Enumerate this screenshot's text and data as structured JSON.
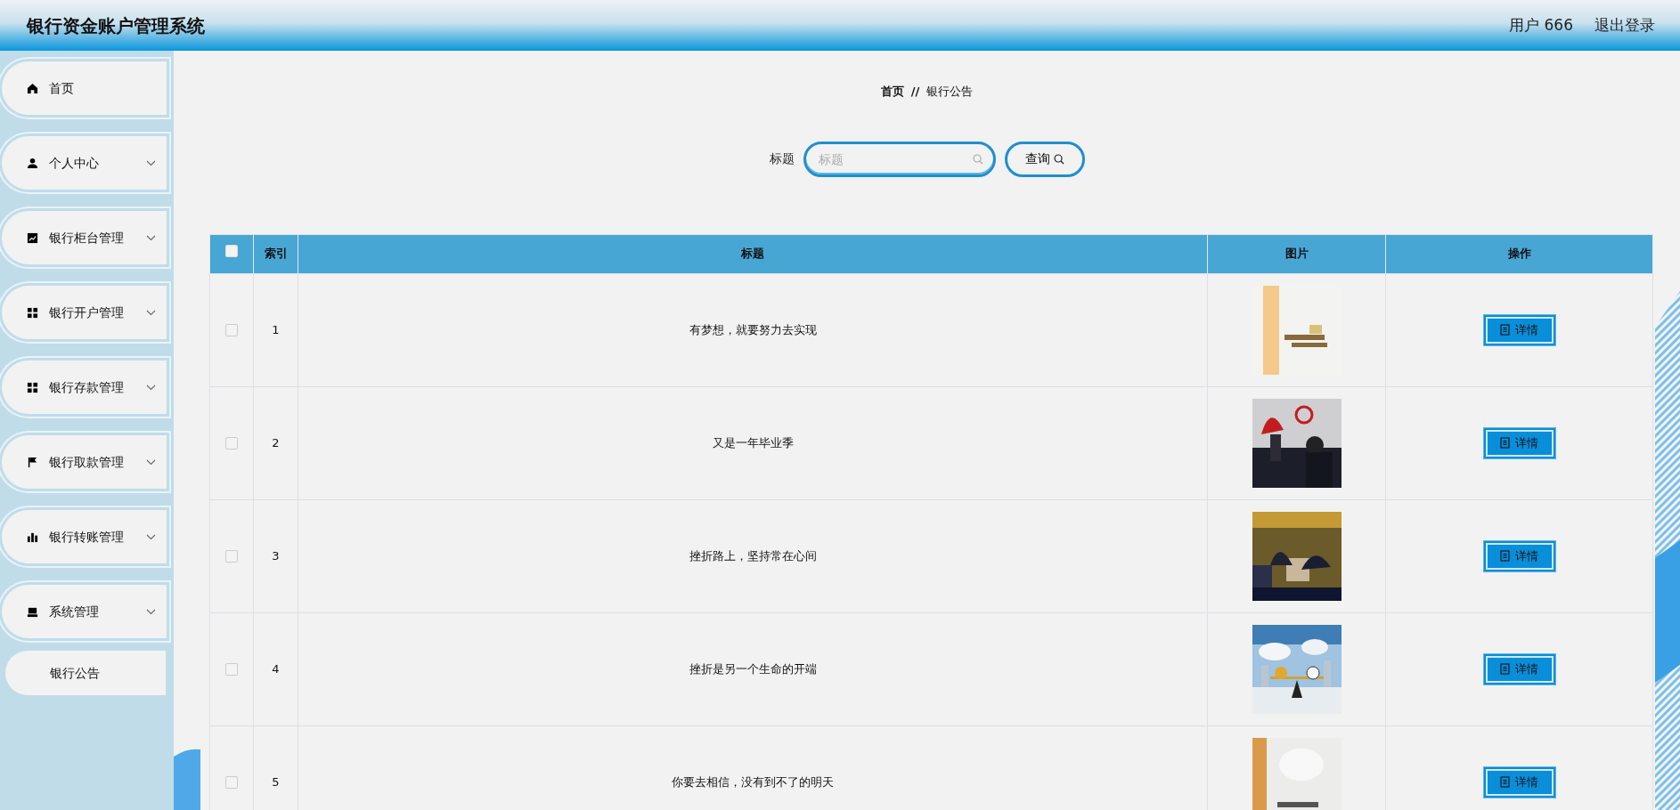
{
  "header": {
    "title": "银行资金账户管理系统",
    "user": "用户 666",
    "logout": "退出登录"
  },
  "sidebar": {
    "items": [
      {
        "label": "首页",
        "kind": "link"
      },
      {
        "label": "个人中心",
        "kind": "menu"
      },
      {
        "label": "银行柜台管理",
        "kind": "menu"
      },
      {
        "label": "银行开户管理",
        "kind": "menu"
      },
      {
        "label": "银行存款管理",
        "kind": "menu"
      },
      {
        "label": "银行取款管理",
        "kind": "menu"
      },
      {
        "label": "银行转账管理",
        "kind": "menu"
      },
      {
        "label": "系统管理",
        "kind": "menu",
        "children": [
          {
            "label": "银行公告"
          }
        ]
      }
    ]
  },
  "breadcrumb": [
    "首页",
    "//",
    "银行公告"
  ],
  "search": {
    "label": "标题",
    "placeholder": "标题",
    "button": "查询"
  },
  "table": {
    "columns": [
      "索引",
      "标题",
      "图片",
      "操作"
    ],
    "header_checked": false,
    "rows": [
      {
        "checked": false,
        "index": "1",
        "title": "有梦想，就要努力去实现",
        "action": "详情"
      },
      {
        "checked": false,
        "index": "2",
        "title": "又是一年毕业季",
        "action": "详情"
      },
      {
        "checked": false,
        "index": "3",
        "title": "挫折路上，坚持常在心间",
        "action": "详情"
      },
      {
        "checked": false,
        "index": "4",
        "title": "挫折是另一个生命的开端",
        "action": "详情"
      },
      {
        "checked": false,
        "index": "5",
        "title": "你要去相信，没有到不了的明天",
        "action": "详情"
      }
    ]
  }
}
